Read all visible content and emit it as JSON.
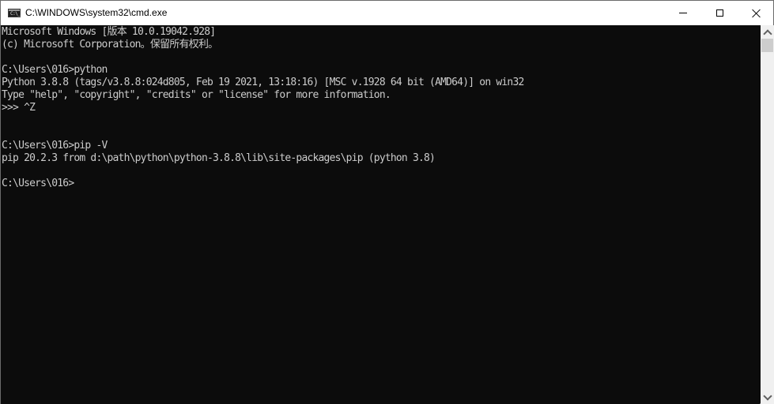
{
  "window": {
    "title": "C:\\WINDOWS\\system32\\cmd.exe",
    "icon": "cmd-icon",
    "icon_glyph": "C:\\_",
    "controls": {
      "minimize": "minimize-icon",
      "maximize": "maximize-icon",
      "close": "close-icon"
    }
  },
  "console": {
    "background": "#0c0c0c",
    "foreground": "#cccccc",
    "lines": [
      "Microsoft Windows [版本 10.0.19042.928]",
      "(c) Microsoft Corporation。保留所有权利。",
      "",
      "C:\\Users\\016>python",
      "Python 3.8.8 (tags/v3.8.8:024d805, Feb 19 2021, 13:18:16) [MSC v.1928 64 bit (AMD64)] on win32",
      "Type \"help\", \"copyright\", \"credits\" or \"license\" for more information.",
      ">>> ^Z",
      "",
      "",
      "C:\\Users\\016>pip -V",
      "pip 20.2.3 from d:\\path\\python\\python-3.8.8\\lib\\site-packages\\pip (python 3.8)",
      "",
      "C:\\Users\\016>"
    ]
  },
  "scrollbar": {
    "up": "chevron-up-icon",
    "down": "chevron-down-icon",
    "position_fraction": 0.0
  }
}
